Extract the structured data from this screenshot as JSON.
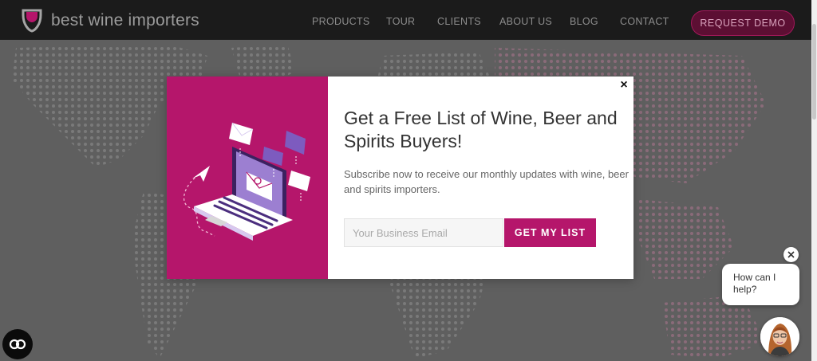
{
  "brand": {
    "name": "best wine importers"
  },
  "nav": {
    "products": "PRODUCTS",
    "tour": "TOUR",
    "clients": "CLIENTS",
    "about": "ABOUT US",
    "blog": "BLOG",
    "contact": "CONTACT",
    "request_demo": "REQUEST DEMO"
  },
  "popup": {
    "title": "Get a Free List of Wine, Beer and Spirits Buyers!",
    "subtitle": "Subscribe now to receive our monthly updates with wine, beer and spirits importers.",
    "email_placeholder": "Your Business Email",
    "email_value": "",
    "submit_label": "GET MY LIST",
    "close_symbol": "×"
  },
  "chat": {
    "message": "How can I help?"
  },
  "icons": {
    "logo": "wine-glass-logo-icon",
    "popup_illustration": "laptop-email-illustration",
    "popup_close": "close-icon",
    "accessibility": "accessibility-icon",
    "chat_close": "close-icon",
    "chat_avatar": "agent-avatar-icon"
  },
  "colors": {
    "brand_magenta": "#b5166b",
    "header_bg": "#1b1b1b",
    "overlay_bg": "#5d5d5d"
  }
}
